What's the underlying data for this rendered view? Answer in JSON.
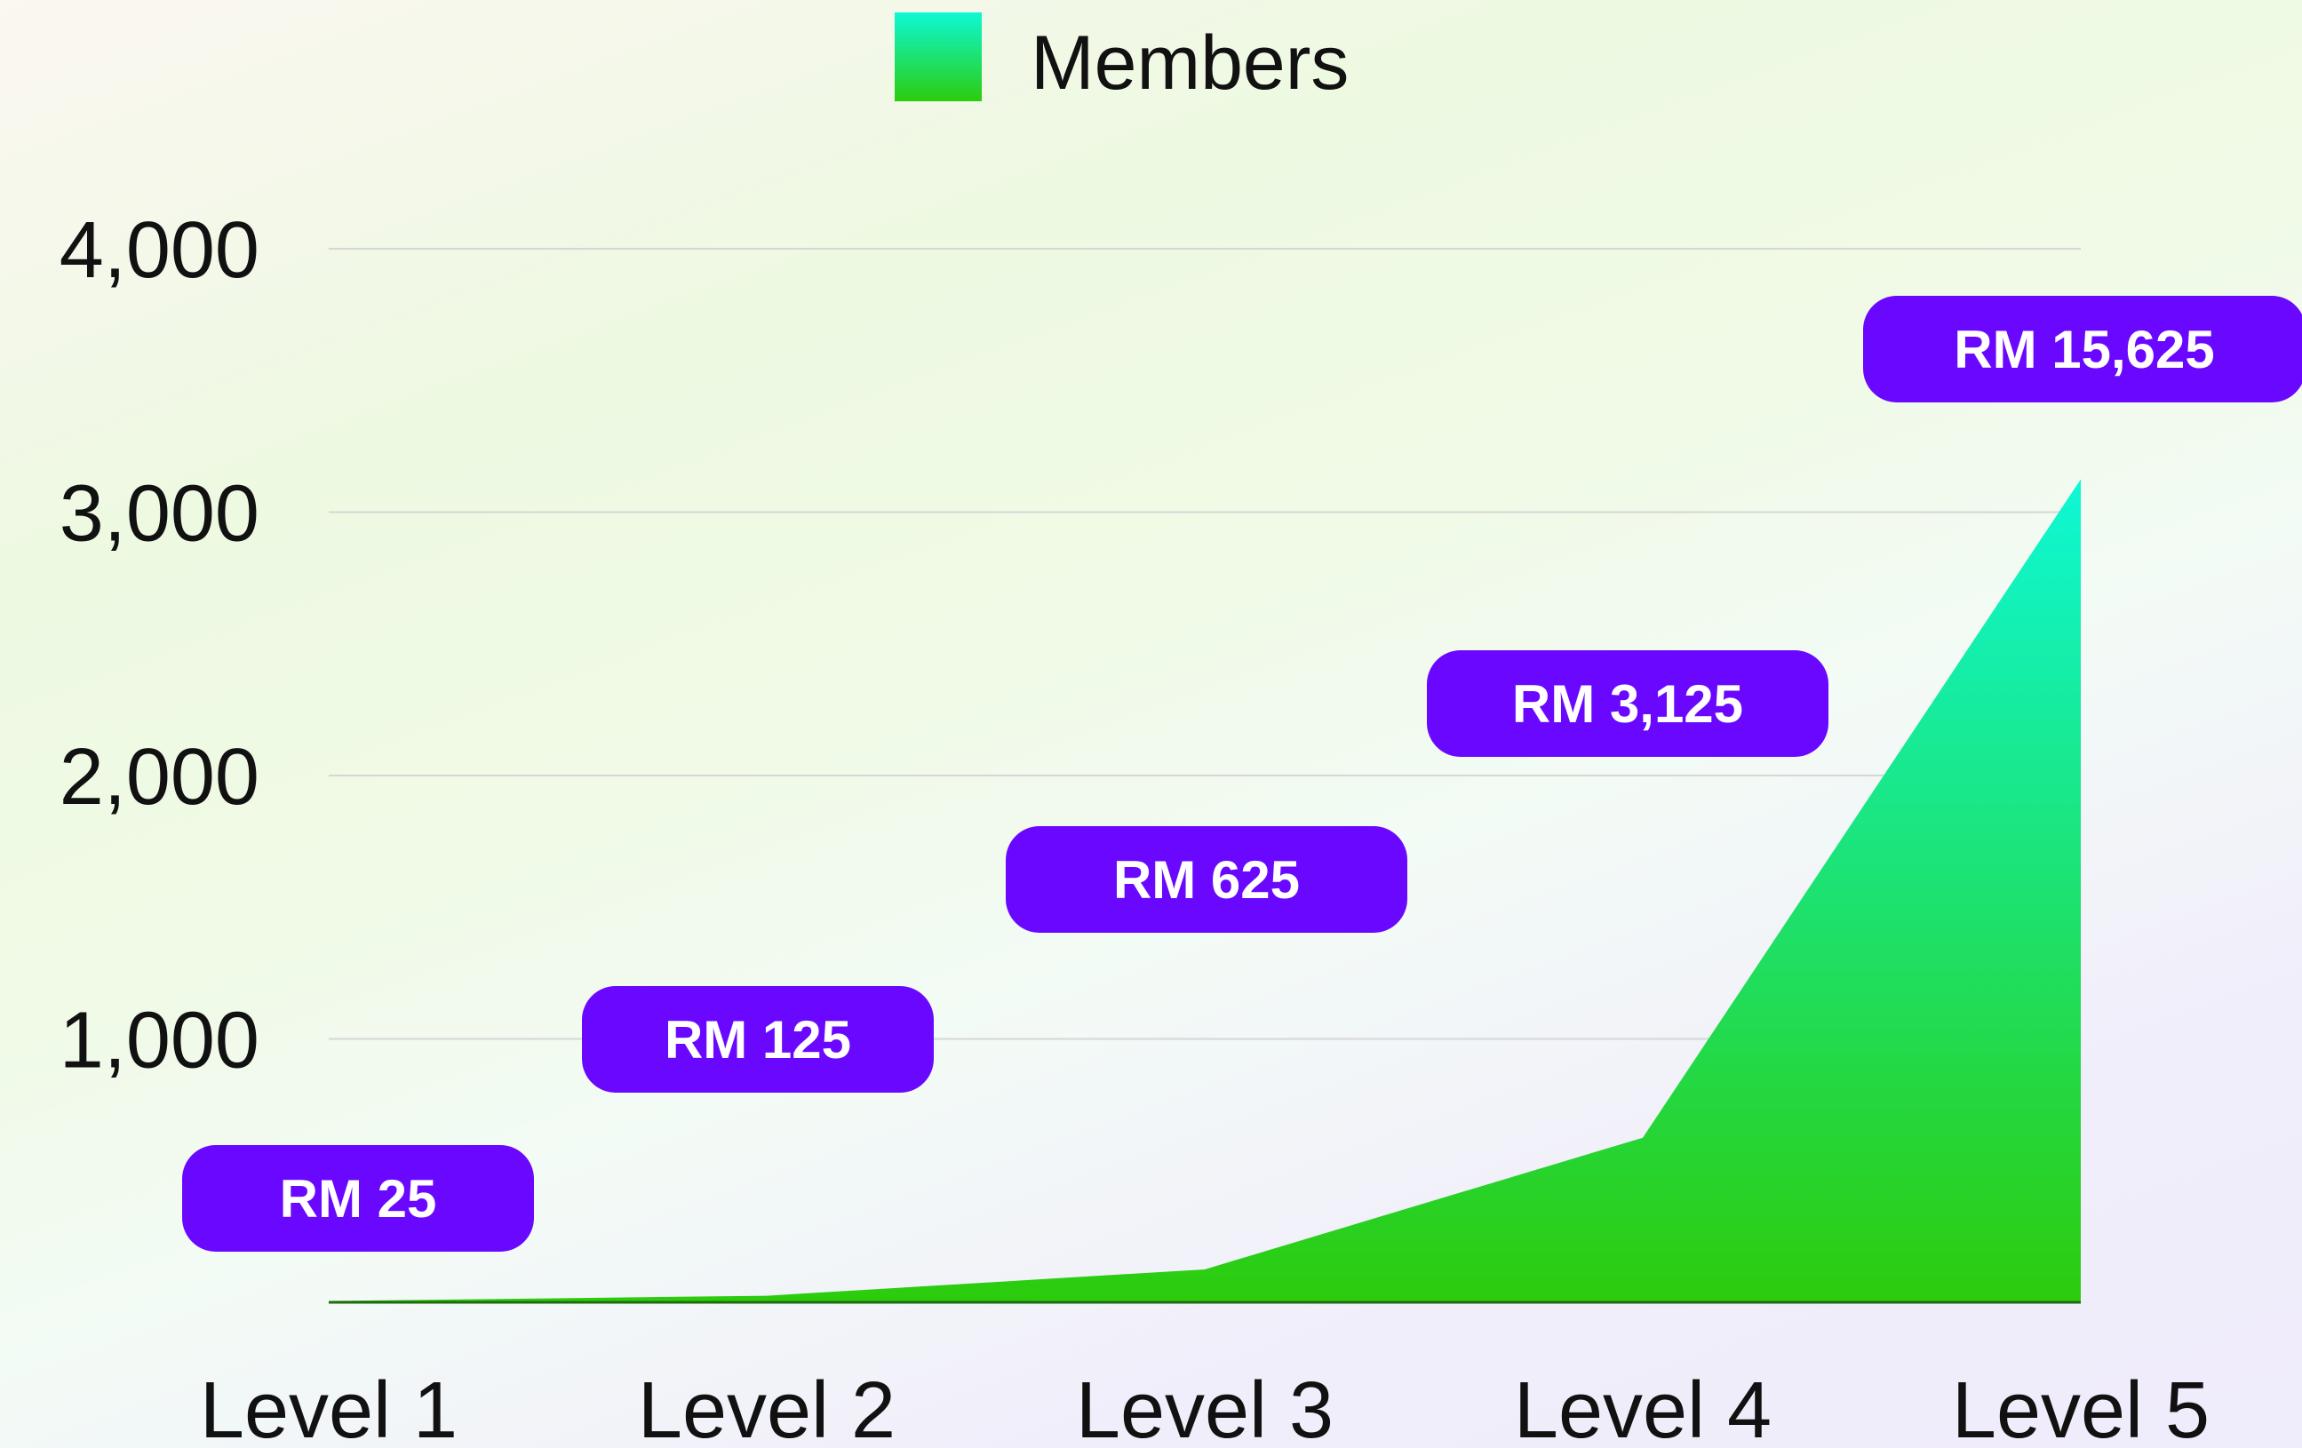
{
  "chart_data": {
    "type": "area",
    "categories": [
      "Level 1",
      "Level 2",
      "Level 3",
      "Level 4",
      "Level 5"
    ],
    "series": [
      {
        "name": "Members",
        "values": [
          5,
          25,
          125,
          625,
          3125
        ]
      }
    ],
    "yticks": [
      "4,000",
      "3,000",
      "2,000",
      "1,000"
    ],
    "ytick_values": [
      4000,
      3000,
      2000,
      1000
    ],
    "ylim": [
      0,
      4000
    ],
    "grid": true,
    "legend_position": "top-center",
    "annotations": [
      "RM 25",
      "RM 125",
      "RM 625",
      "RM 3,125",
      "RM 15,625"
    ],
    "colors": {
      "area_top": "#0ef8d6",
      "area_bottom": "#2ccc0c",
      "pill": "#6a08ff",
      "pill_text": "#ffffff",
      "grid": "#d6d6d6",
      "text": "#111111"
    }
  }
}
